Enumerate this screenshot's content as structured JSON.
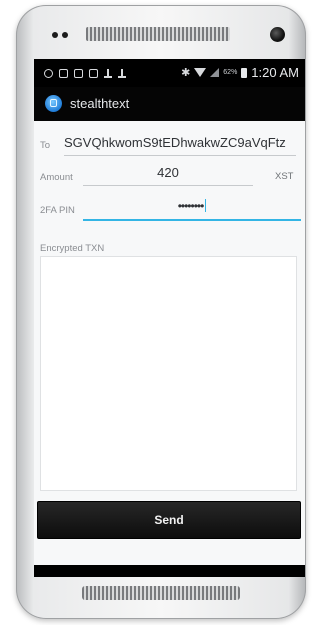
{
  "status_bar": {
    "battery_percent": "62%",
    "time": "1:20 AM",
    "icons": [
      "chat-icon",
      "image-icon",
      "mail-icon",
      "mail-icon",
      "upload-icon",
      "download-icon",
      "bluetooth-icon",
      "wifi-icon",
      "signal-icon",
      "battery-icon"
    ]
  },
  "action_bar": {
    "app_title": "stealthtext",
    "app_icon": "stealthtext-logo-icon"
  },
  "form": {
    "to_label": "To",
    "to_value": "SGVQhkwomS9tEDhwakwZC9aVqFtz",
    "amount_label": "Amount",
    "amount_value": "420",
    "currency": "XST",
    "pin_label": "2FA PIN",
    "pin_value": "••••••••",
    "encrypted_label": "Encrypted TXN",
    "encrypted_value": ""
  },
  "buttons": {
    "send_label": "Send"
  },
  "colors": {
    "accent": "#33b5e5",
    "button": "#111111",
    "background": "#f7f8f9"
  }
}
